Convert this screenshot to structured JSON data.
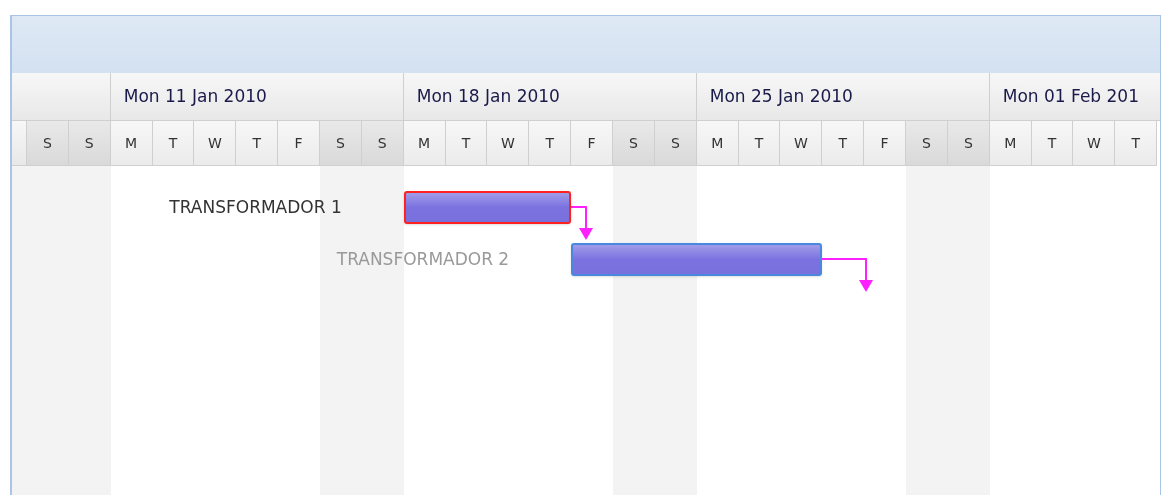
{
  "weeks": [
    {
      "label": "Mon 11 Jan 2010"
    },
    {
      "label": "Mon 18 Jan 2010"
    },
    {
      "label": "Mon 25 Jan 2010"
    },
    {
      "label": "Mon 01 Feb 201"
    }
  ],
  "lead_days": [
    {
      "letter": "S",
      "weekend": true
    },
    {
      "letter": "S",
      "weekend": true
    }
  ],
  "days": [
    {
      "letter": "M",
      "weekend": false
    },
    {
      "letter": "T",
      "weekend": false
    },
    {
      "letter": "W",
      "weekend": false
    },
    {
      "letter": "T",
      "weekend": false
    },
    {
      "letter": "F",
      "weekend": false
    },
    {
      "letter": "S",
      "weekend": true
    },
    {
      "letter": "S",
      "weekend": true
    },
    {
      "letter": "M",
      "weekend": false
    },
    {
      "letter": "T",
      "weekend": false
    },
    {
      "letter": "W",
      "weekend": false
    },
    {
      "letter": "T",
      "weekend": false
    },
    {
      "letter": "F",
      "weekend": false
    },
    {
      "letter": "S",
      "weekend": true
    },
    {
      "letter": "S",
      "weekend": true
    },
    {
      "letter": "M",
      "weekend": false
    },
    {
      "letter": "T",
      "weekend": false
    },
    {
      "letter": "W",
      "weekend": false
    },
    {
      "letter": "T",
      "weekend": false
    },
    {
      "letter": "F",
      "weekend": false
    },
    {
      "letter": "S",
      "weekend": true
    },
    {
      "letter": "S",
      "weekend": true
    },
    {
      "letter": "M",
      "weekend": false
    },
    {
      "letter": "T",
      "weekend": false
    },
    {
      "letter": "W",
      "weekend": false
    },
    {
      "letter": "T",
      "weekend": false
    }
  ],
  "tasks": [
    {
      "name": "TRANSFORMADOR 1",
      "selected": true
    },
    {
      "name": "TRANSFORMADOR 2",
      "selected": false
    }
  ]
}
